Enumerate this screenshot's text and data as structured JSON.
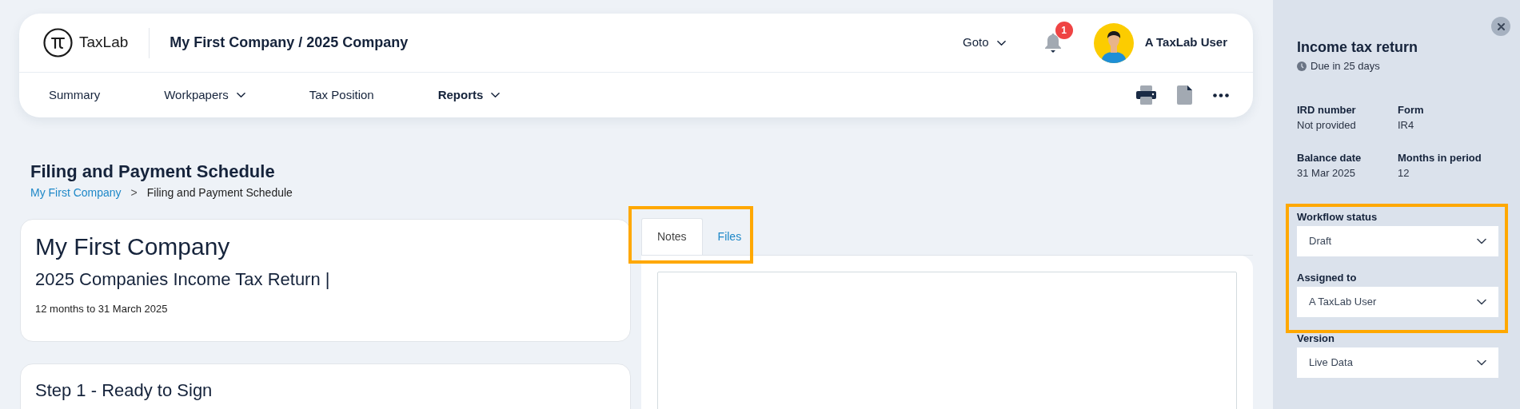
{
  "header": {
    "logo_text": "TaxLab",
    "title": "My First Company / 2025 Company",
    "goto": "Goto",
    "notification_count": "1",
    "user_name": "A TaxLab User"
  },
  "nav": [
    {
      "label": "Summary",
      "dropdown": false,
      "selected": false
    },
    {
      "label": "Workpapers",
      "dropdown": true,
      "selected": false
    },
    {
      "label": "Tax Position",
      "dropdown": false,
      "selected": false
    },
    {
      "label": "Reports",
      "dropdown": true,
      "selected": true
    }
  ],
  "page": {
    "title": "Filing and Payment Schedule",
    "separator": ">",
    "breadcrumb": [
      {
        "label": "My First Company",
        "kind": "link"
      },
      {
        "label": "Filing and Payment Schedule",
        "kind": "current"
      }
    ]
  },
  "summary_card": {
    "company": "My First Company",
    "return_title": "2025 Companies Income Tax Return |",
    "period": "12 months to 31 March 2025"
  },
  "step_card": {
    "title": "Step 1 - Ready to Sign"
  },
  "tabs": [
    {
      "label": "Notes",
      "selected": true
    },
    {
      "label": "Files",
      "selected": false
    }
  ],
  "side_panel": {
    "title": "Income tax return",
    "due": "Due in 25 days",
    "details": [
      {
        "label": "IRD number",
        "value": "Not provided"
      },
      {
        "label": "Form",
        "value": "IR4"
      },
      {
        "label": "Balance date",
        "value": "31 Mar 2025"
      },
      {
        "label": "Months in period",
        "value": "12"
      }
    ],
    "selects": [
      {
        "label": "Workflow status",
        "value": "Draft"
      },
      {
        "label": "Assigned to",
        "value": "A TaxLab User"
      },
      {
        "label": "Version",
        "value": "Live Data"
      }
    ]
  }
}
